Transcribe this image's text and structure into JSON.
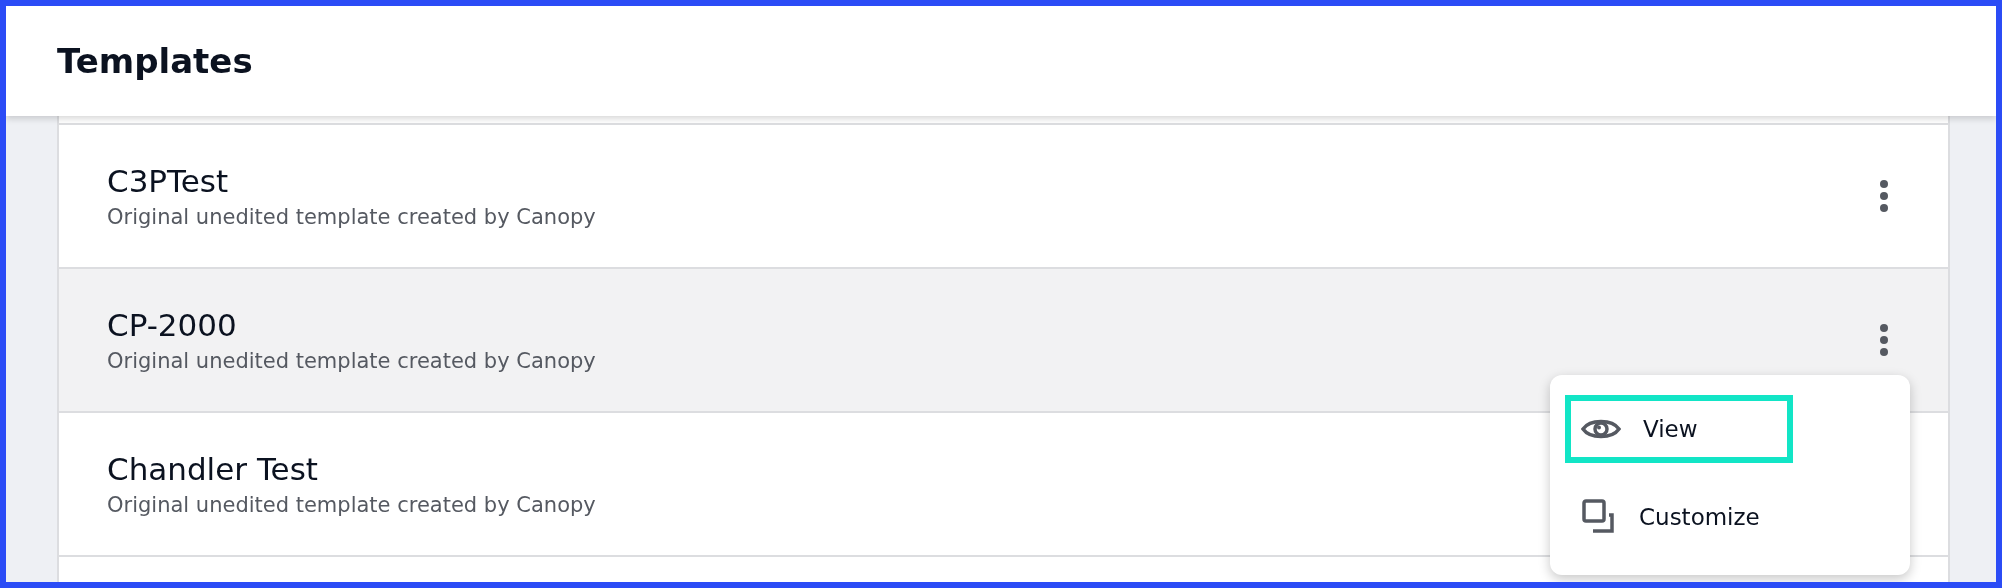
{
  "header": {
    "title": "Templates"
  },
  "templates": [
    {
      "name": "C3PTest",
      "description": "Original unedited template created by Canopy",
      "highlighted": false
    },
    {
      "name": "CP-2000",
      "description": "Original unedited template created by Canopy",
      "highlighted": true
    },
    {
      "name": "Chandler Test",
      "description": "Original unedited template created by Canopy",
      "highlighted": false
    }
  ],
  "menu": {
    "items": [
      {
        "kind": "view",
        "label": "View",
        "focused": true
      },
      {
        "kind": "customize",
        "label": "Customize",
        "focused": false
      }
    ]
  }
}
